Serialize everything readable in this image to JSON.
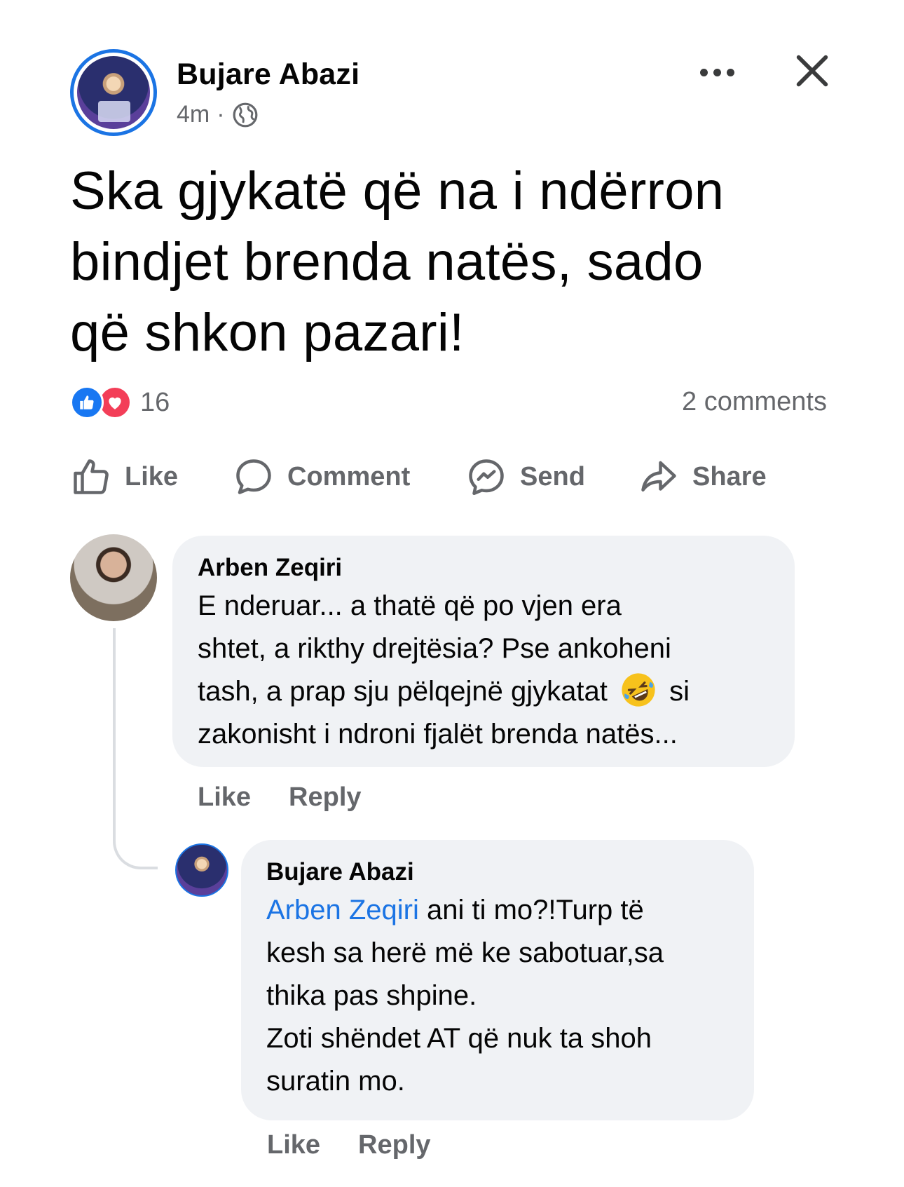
{
  "post": {
    "author": "Bujare Abazi",
    "time": "4m",
    "separator": "·",
    "text_lines": [
      "Ska gjykatë që na i ndërron",
      "bindjet brenda natës, sado",
      "që shkon pazari!"
    ],
    "reaction_count": "16",
    "comments_count": "2 comments"
  },
  "actions": {
    "like": "Like",
    "comment": "Comment",
    "send": "Send",
    "share": "Share"
  },
  "comments": [
    {
      "name": "Arben Zeqiri",
      "text_line1": "E nderuar... a thatë që po vjen era",
      "text_line2": "shtet, a rikthy drejtësia? Pse ankoheni",
      "text_line3a": "tash, a prap sju pëlqejnë gjykatat",
      "text_line3b": "si",
      "text_line4": "zakonisht i ndroni fjalët brenda natës...",
      "like": "Like",
      "reply": "Reply"
    },
    {
      "name": "Bujare Abazi",
      "mention": "Arben Zeqiri",
      "text_line1": " ani ti mo?!Turp të",
      "text_line2": "kesh sa herë më ke sabotuar,sa",
      "text_line3": "thika pas shpine.",
      "text_line4": "Zoti shëndet AT që nuk ta shoh",
      "text_line5": "suratin mo.",
      "like": "Like",
      "reply": "Reply"
    }
  ],
  "icons": {
    "globe": "globe-icon",
    "more": "more-options-icon",
    "close": "close-icon",
    "like_reaction": "thumbs-up-icon",
    "love_reaction": "heart-icon",
    "emoji": "rolling-on-floor-laughing-emoji"
  },
  "colors": {
    "accent": "#1b74e4",
    "secondary_text": "#65676b",
    "bubble": "#f0f2f5",
    "love": "#f33e58"
  }
}
